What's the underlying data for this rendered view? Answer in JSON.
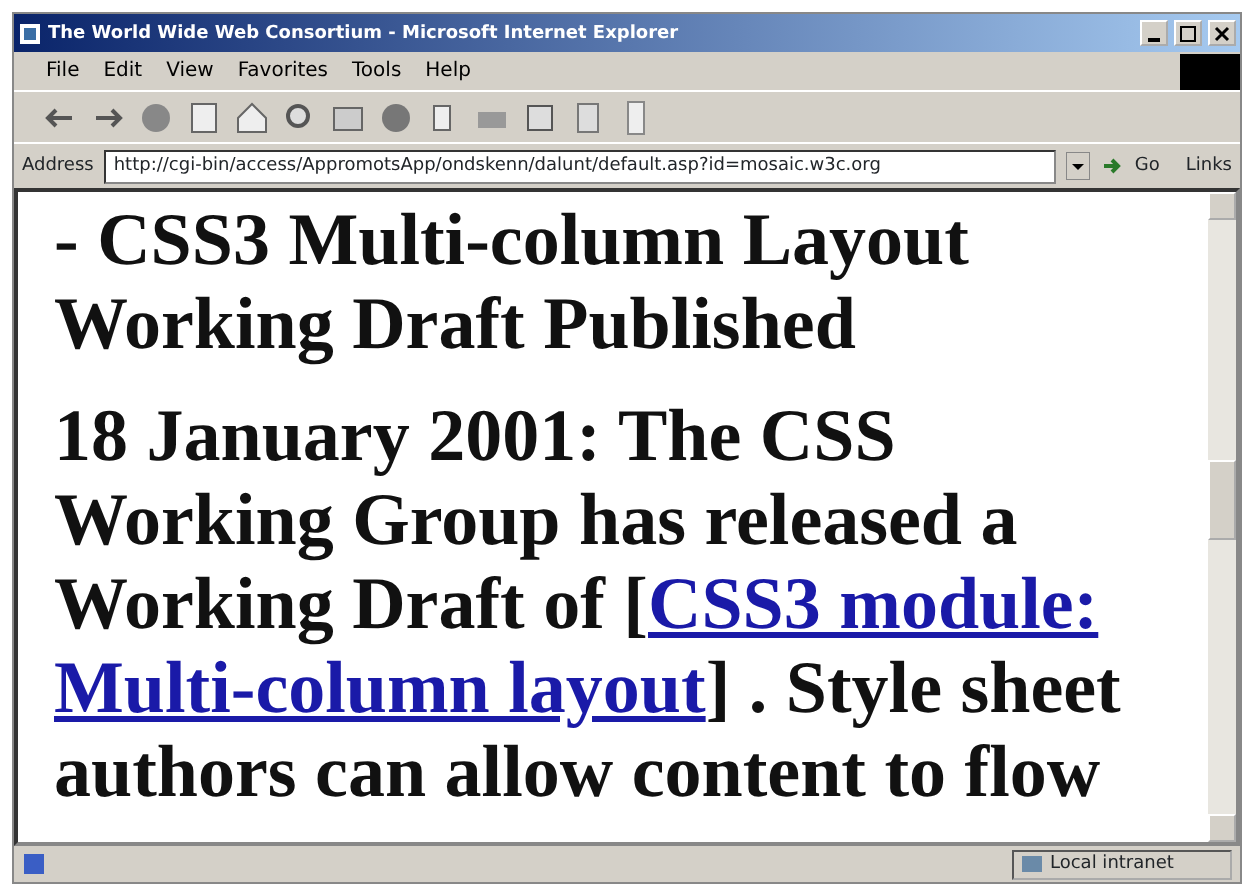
{
  "window": {
    "title": "The World Wide Web Consortium - Microsoft Internet Explorer"
  },
  "menu": [
    "File",
    "Edit",
    "View",
    "Favorites",
    "Tools",
    "Help"
  ],
  "address_bar": {
    "label": "Address",
    "url": "http://cgi-bin/access/AppromotsApp/ondskenn/dalunt/default.asp?id=mosaic.w3c.org",
    "go": "Go",
    "links": "Links"
  },
  "content": {
    "heading": "- CSS3 Multi-column Layout Working Draft Published",
    "paragraph": {
      "before": "18 January 2001: The CSS Working Group has released a Working Draft of [",
      "link_lines": [
        "CSS3 module:",
        "Multi-column layout"
      ],
      "after": "] . Style sheet authors can allow content to flow"
    }
  },
  "status_bar": {
    "zone": "Local intranet"
  }
}
